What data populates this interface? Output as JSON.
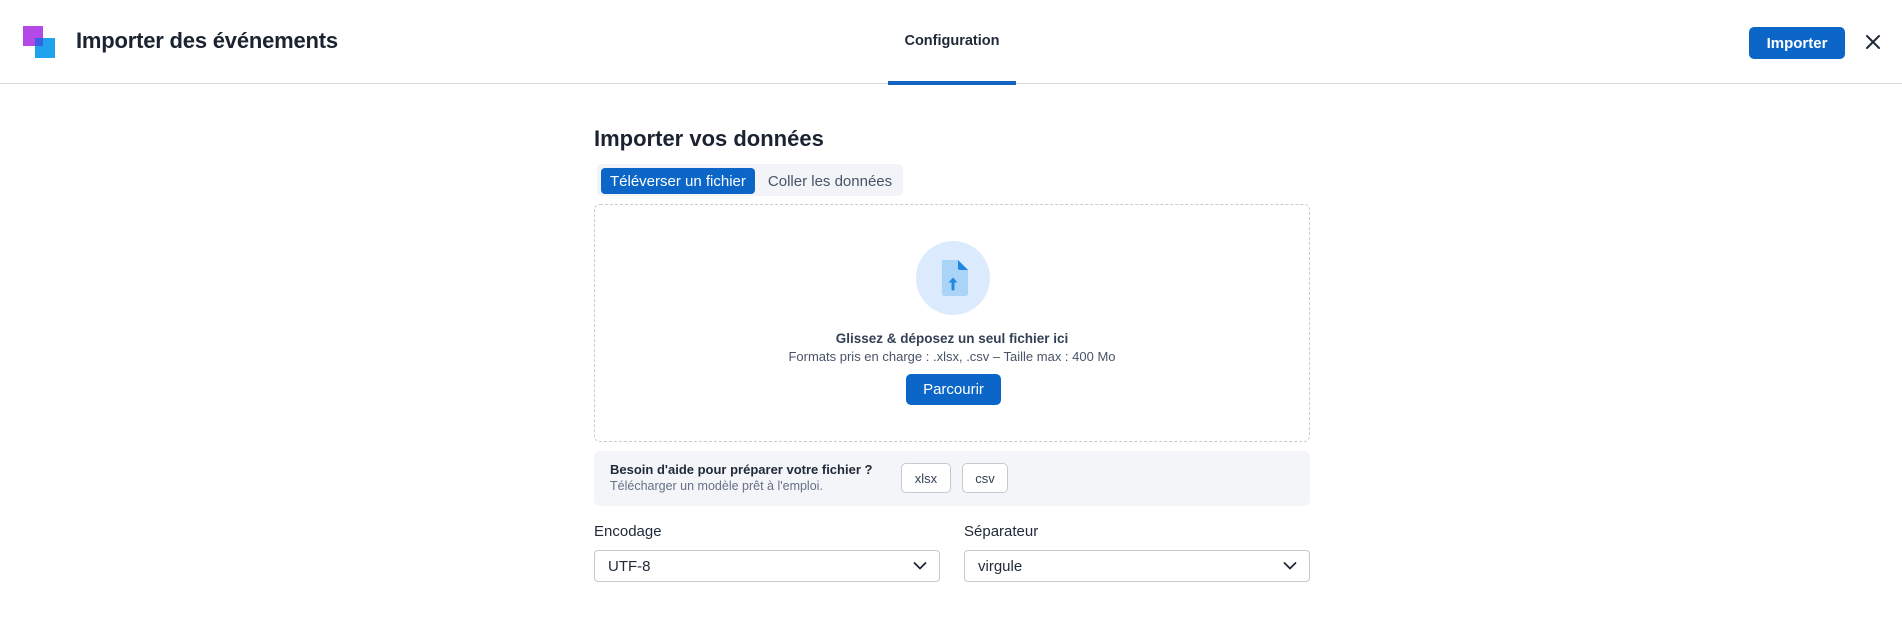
{
  "header": {
    "title": "Importer des événements",
    "tabs": [
      {
        "label": "Configuration",
        "active": true
      }
    ],
    "import_label": "Importer",
    "close_icon": "close-icon"
  },
  "main": {
    "title": "Importer vos données",
    "segments": [
      {
        "label": "Téléverser un fichier",
        "active": true
      },
      {
        "label": "Coller les données",
        "active": false
      }
    ],
    "dropzone": {
      "icon": "file-upload-icon",
      "title": "Glissez & déposez un seul fichier ici",
      "subtitle": "Formats pris en charge : .xlsx, .csv – Taille max : 400 Mo",
      "browse_label": "Parcourir"
    },
    "help": {
      "title": "Besoin d'aide pour préparer votre fichier ?",
      "subtitle": "Télécharger un modèle prêt à l'emploi.",
      "templates": [
        "xlsx",
        "csv"
      ]
    },
    "encoding": {
      "label": "Encodage",
      "value": "UTF-8"
    },
    "separator": {
      "label": "Séparateur",
      "value": "virgule"
    }
  },
  "colors": {
    "primary": "#0b66c7",
    "logo_purple": "#b34ae8",
    "logo_blue": "#1fa3ee",
    "icon_bg": "#dbeafc"
  }
}
